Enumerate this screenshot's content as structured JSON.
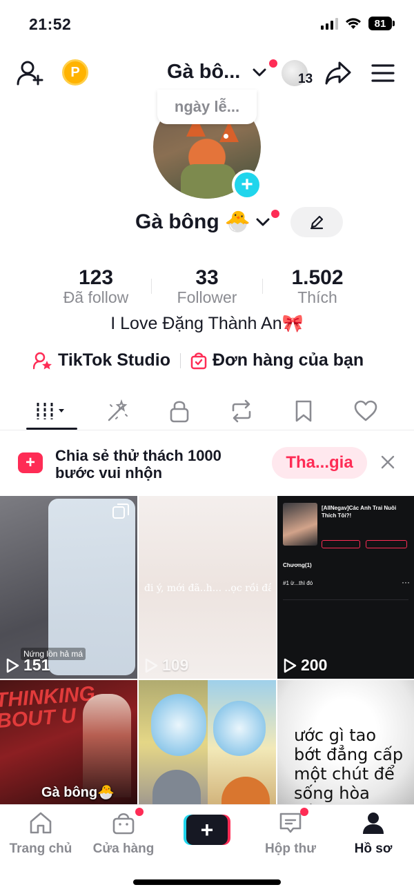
{
  "status_bar": {
    "time": "21:52",
    "battery": "81"
  },
  "top_bar": {
    "username": "Gà bô...",
    "ball_count": "13",
    "coin_letter": "P"
  },
  "profile": {
    "note": "ngày lễ...",
    "nickname": "Gà bông",
    "nickname_emoji": "🐣",
    "stats": [
      {
        "value": "123",
        "label": "Đã follow"
      },
      {
        "value": "33",
        "label": "Follower"
      },
      {
        "value": "1.502",
        "label": "Thích"
      }
    ],
    "bio": "I Love Đặng Thành An🎀",
    "links": {
      "studio": "TikTok Studio",
      "orders": "Đơn hàng của bạn"
    }
  },
  "banner": {
    "line1": "Chia sẻ thử thách 1000",
    "line2": "bước vui nhộn",
    "join": "Tha...gia"
  },
  "videos": [
    {
      "views": "151",
      "caption": "Nứng lồn hả má"
    },
    {
      "views": "109",
      "caption": "đi ý, mới đã..h... ..ọc rồi đây"
    },
    {
      "views": "200",
      "title": "[AllNegav]Các Anh Trai Nuôi Thích Tôi?!",
      "chapter": "Chương(1)",
      "item": "#1 ừ...thì đó"
    },
    {
      "views": "",
      "overlay": "THINKING BOUT U",
      "caption": "Gà bông🐣"
    },
    {
      "views": ""
    },
    {
      "views": "",
      "text": "ước gì tao bớt đẳng cấp một chút để sống hòa đồng thì"
    }
  ],
  "bottom_nav": [
    "Trang chủ",
    "Cửa hàng",
    "Hộp thư",
    "Hồ sơ"
  ],
  "colors": {
    "accent": "#fe2c55",
    "cyan": "#20d5ec",
    "text": "#161823",
    "muted": "#8a8b91"
  }
}
